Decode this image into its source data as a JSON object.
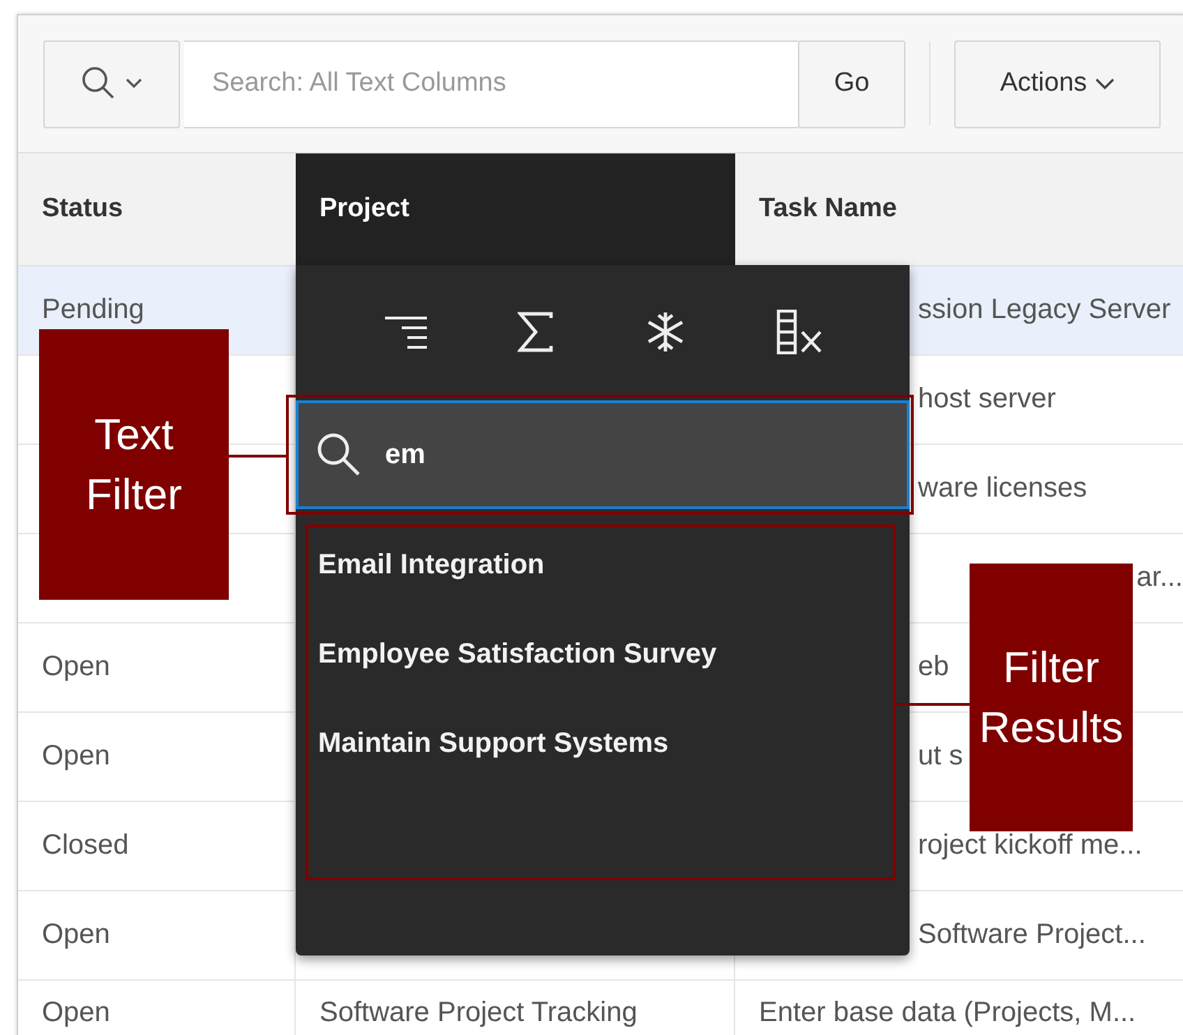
{
  "toolbar": {
    "search_placeholder": "Search: All Text Columns",
    "go_button": "Go",
    "actions_button": "Actions"
  },
  "table": {
    "columns": [
      {
        "label": "Status",
        "active": false
      },
      {
        "label": "Project",
        "active": true
      },
      {
        "label": "Task Name",
        "active": false
      }
    ],
    "rows": [
      {
        "selected": true,
        "status": "Pending",
        "task": {
          "text": "ssion Legacy Server",
          "kind": "clipped"
        }
      },
      {
        "selected": false,
        "task": {
          "text": "host server",
          "kind": "clipped"
        }
      },
      {
        "selected": false,
        "task": {
          "text": "ware licenses",
          "kind": "clipped"
        }
      },
      {
        "selected": false,
        "task": {
          "text": "ar...",
          "kind": "end"
        }
      },
      {
        "selected": false,
        "status": "Open",
        "task": {
          "text": "eb",
          "kind": "clipped"
        }
      },
      {
        "selected": false,
        "status": "Open",
        "task": {
          "text": "ut s",
          "kind": "clipped"
        }
      },
      {
        "selected": false,
        "status": "Closed",
        "task": {
          "text": "roject kickoff me...",
          "kind": "clipped"
        }
      },
      {
        "selected": false,
        "status": "Open",
        "task": {
          "text": "Software Project...",
          "kind": "clipped"
        }
      },
      {
        "selected": false,
        "status": "Open",
        "project": "Software Project Tracking",
        "task": {
          "text": "Enter base data (Projects, M...",
          "kind": "whole"
        }
      }
    ]
  },
  "column_menu": {
    "filter": {
      "value": "em"
    },
    "results": [
      "Email Integration",
      "Employee Satisfaction Survey",
      "Maintain Support Systems"
    ]
  },
  "annotations": [
    {
      "label": "Text Filter",
      "kind": "filter"
    },
    {
      "label": "Filter Results",
      "kind": "results"
    }
  ]
}
